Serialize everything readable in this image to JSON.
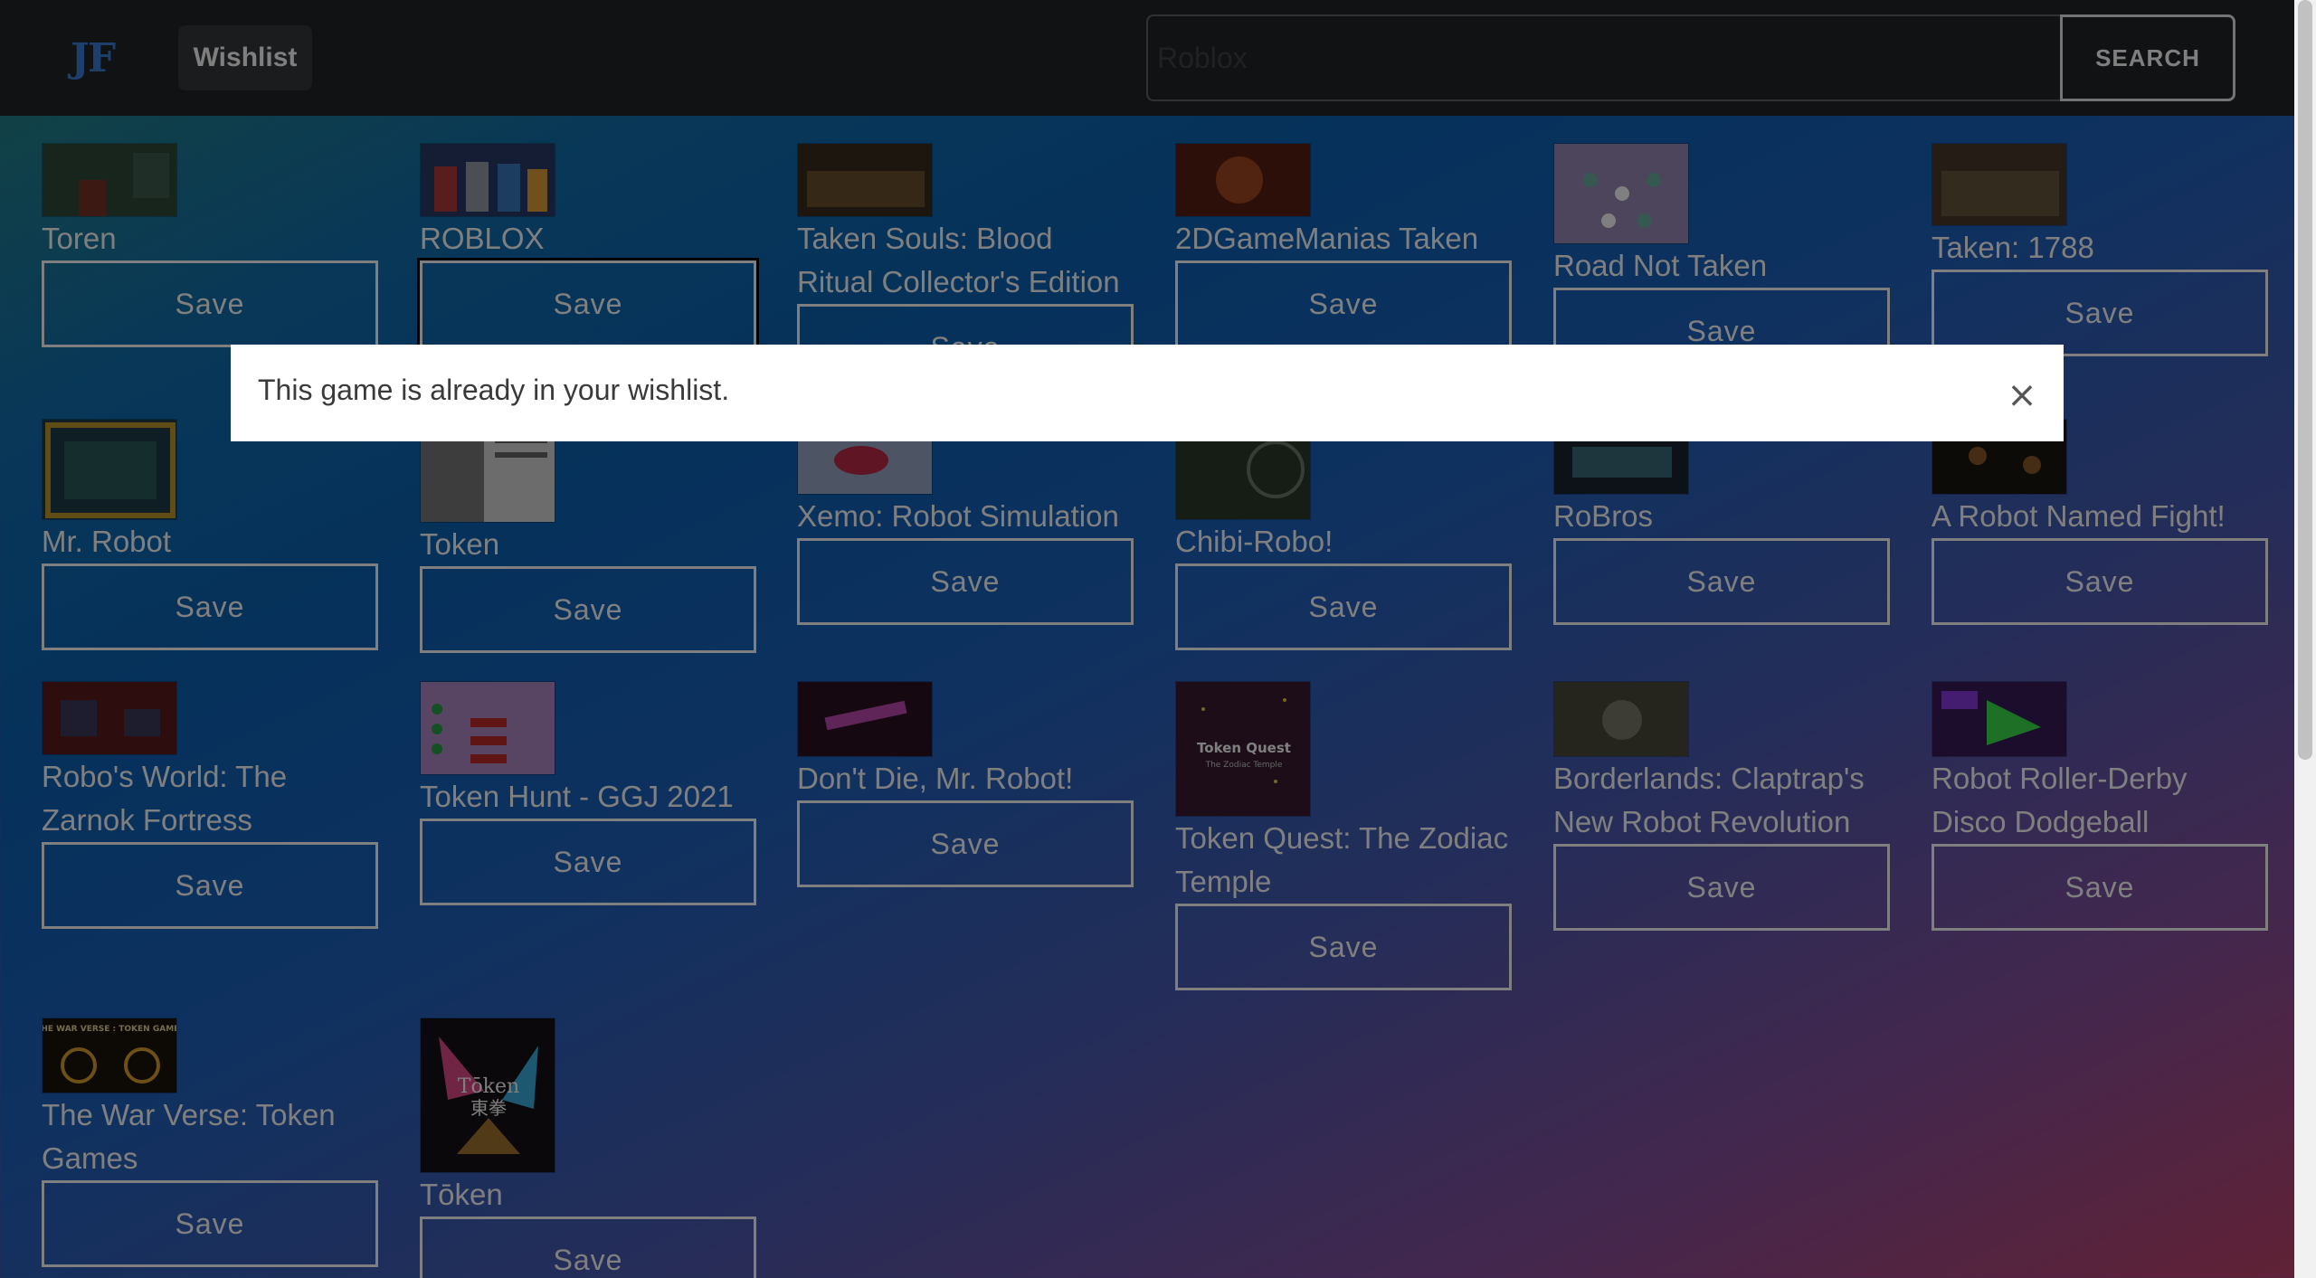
{
  "navbar": {
    "logo": "JF",
    "wishlist_label": "Wishlist",
    "search_placeholder": "Roblox",
    "search_label": "SEARCH"
  },
  "save_label": "Save",
  "games": [
    {
      "title": "Toren",
      "thumb": {
        "bg": "#2f4a3a",
        "accent": "#7a3328"
      }
    },
    {
      "title": "ROBLOX",
      "thumb": {
        "bg": "#2b3a6a",
        "accent": "#b03a3a"
      }
    },
    {
      "title": "Taken Souls: Blood Ritual Collector's Edition",
      "thumb": {
        "bg": "#3a2c1c",
        "accent": "#8a6a3a"
      }
    },
    {
      "title": "2DGameManias Taken",
      "thumb": {
        "bg": "#5a1e12",
        "accent": "#c25a2a"
      }
    },
    {
      "title": "Road Not Taken",
      "thumb": {
        "bg": "#9a8ab8",
        "accent": "#6ab0a0"
      }
    },
    {
      "title": "Taken: 1788",
      "thumb": {
        "bg": "#4a3a2a",
        "accent": "#7a6a4a"
      }
    },
    {
      "title": "Mr. Robot",
      "thumb": {
        "bg": "#1e3a4a",
        "accent": "#c09a2a"
      }
    },
    {
      "title": "Token",
      "thumb": {
        "bg": "#7a7a7a",
        "accent": "#d8d8d8"
      }
    },
    {
      "title": "Xemo: Robot Simulation",
      "thumb": {
        "bg": "#9aa8c8",
        "accent": "#c02a4a"
      }
    },
    {
      "title": "Chibi-Robo!",
      "thumb": {
        "bg": "#2a3a2a",
        "accent": "#6a7a6a"
      }
    },
    {
      "title": "RoBros",
      "thumb": {
        "bg": "#1a2230",
        "accent": "#3a6a7a"
      }
    },
    {
      "title": "A Robot Named Fight!",
      "thumb": {
        "bg": "#1a1610",
        "accent": "#8a5a2a"
      }
    },
    {
      "title": "Robo's World: The Zarnok Fortress",
      "thumb": {
        "bg": "#5a1a1a",
        "accent": "#3a3a5a"
      }
    },
    {
      "title": "Token Hunt - GGJ 2021",
      "thumb": {
        "bg": "#b08ac8",
        "accent": "#2aa04a"
      }
    },
    {
      "title": "Don't Die, Mr. Robot!",
      "thumb": {
        "bg": "#2a1020",
        "accent": "#c04ab0"
      }
    },
    {
      "title": "Token Quest: The Zodiac Temple",
      "thumb": {
        "bg": "#3a1a30",
        "accent": "#e8c84a",
        "text": "Token Quest",
        "subtext": "The Zodiac Temple"
      }
    },
    {
      "title": "Borderlands: Claptrap's New Robot Revolution",
      "thumb": {
        "bg": "#4a4a3a",
        "accent": "#7a7a6a"
      }
    },
    {
      "title": "Robot Roller-Derby Disco Dodgeball",
      "thumb": {
        "bg": "#3a1a5a",
        "accent": "#3ae04a"
      }
    },
    {
      "title": "The War Verse: Token Games",
      "thumb": {
        "bg": "#1a140a",
        "accent": "#d8a02a",
        "text": "THE WAR VERSE : TOKEN GAMES"
      }
    },
    {
      "title": "Tōken",
      "thumb": {
        "bg": "#141014",
        "accent": "#e04a8a",
        "text": "Tōken",
        "subtext": "東拳"
      }
    }
  ],
  "modal": {
    "message": "This game is already in your wishlist.",
    "close_symbol": "×"
  }
}
